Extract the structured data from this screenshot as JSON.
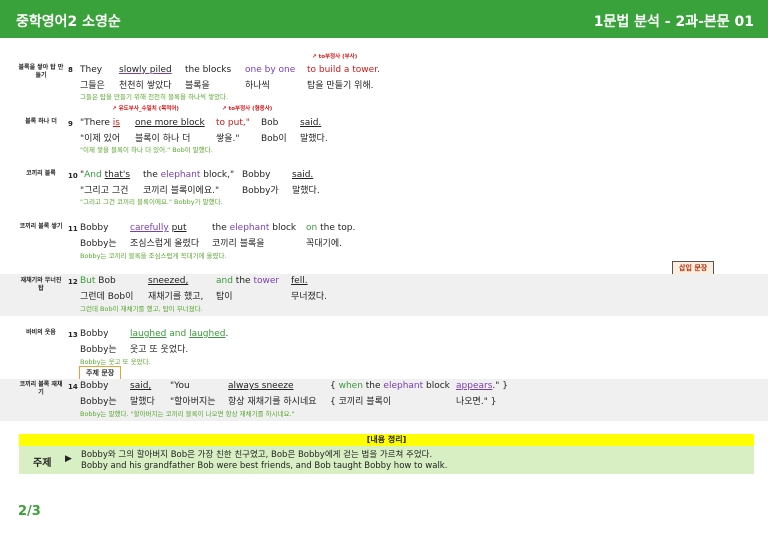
{
  "header": {
    "title_left": "중학영어2 소영순",
    "title_right": "1문법 분석 - 2과-본문 01"
  },
  "rows": [
    {
      "label": "블록을 쌓아 탑 만들기",
      "num": "8",
      "e": [
        "They",
        "slowly piled",
        "the blocks",
        "one by one",
        "to build a tower."
      ],
      "k": [
        "그들은",
        "천천히 쌓았다",
        "블록을",
        "하나씩",
        "탑을 만들기 위해."
      ],
      "small": "그들은 탑을 만들기 위해 천천히 블록을 하나씩 쌓았다.",
      "notes": [
        "to부정사 (부사)"
      ]
    },
    {
      "label": "블록 하나 더",
      "num": "9",
      "e": [
        "\"There is",
        "one more block",
        "to put,\"",
        "Bob",
        "said."
      ],
      "k": [
        "\"이제 있어",
        "블록이 하나 더",
        "쌓을.\"",
        "Bob이",
        "말했다."
      ],
      "small": "\"이제 쌓을 블록이 하나 더 있어.\" Bob이 말했다.",
      "notes": [
        "유도부사_수일치 (목적어)",
        "to부정사 (형용사)"
      ]
    },
    {
      "label": "코끼리 블록",
      "num": "10",
      "e": [
        "\"And that's",
        "the elephant block,\"",
        "Bobby",
        "said."
      ],
      "k": [
        "\"그리고 그건",
        "코끼리 블록이에요.\"",
        "Bobby가",
        "말했다."
      ],
      "small": "\"그리고 그건 코끼리 블록이에요.\" Bobby가 말했다."
    },
    {
      "label": "코끼리 블록 쌓기",
      "num": "11",
      "e": [
        "Bobby",
        "carefully put",
        "the elephant block",
        "on the top."
      ],
      "k": [
        "Bobby는",
        "조심스럽게 올렸다",
        "코끼리 블록을",
        "꼭대기에."
      ],
      "small": "Bobby는 코끼리 블록을 조심스럽게 꼭대기에 올렸다."
    },
    {
      "label": "재채기와 무너진 탑",
      "num": "12",
      "e": [
        "But Bob",
        "sneezed,",
        "and the tower",
        "fell."
      ],
      "k": [
        "그런데 Bob이",
        "재채기를 했고,",
        "탑이",
        "무너졌다."
      ],
      "small": "그런데 Bob이 재채기를 했고, 탑이 무너졌다."
    },
    {
      "label": "바비의 웃음",
      "num": "13",
      "e": [
        "Bobby",
        "laughed and laughed."
      ],
      "k": [
        "Bobby는",
        "웃고 또 웃었다."
      ],
      "small": "Bobby는 웃고 또 웃었다."
    },
    {
      "label": "코끼리 블록 재채기",
      "num": "14",
      "e": [
        "Bobby",
        "said,",
        "\"You",
        "always sneeze",
        "{ when the elephant block",
        "appears.\" }"
      ],
      "k": [
        "Bobby는",
        "말했다",
        "\"할아버지는",
        "항상 재채기를 하시네요",
        "{ 코끼리 블록이",
        "나오면.\" }"
      ],
      "small": "Bobby는 말했다. \"할아버지는 코끼리 블록이 나오면 항상 재채기를 하시네요.\""
    }
  ],
  "tags": {
    "insert": "삽입 문장",
    "topic": "주제 문장"
  },
  "summary": {
    "heading": "[내용 정리]",
    "key": "주제",
    "arrow": "▶",
    "line1": "Bobby와 그의 할아버지 Bob은 가장 친한 친구였고, Bob은 Bobby에게 걷는 법을 가르쳐 주었다.",
    "line2": "Bobby and his grandfather Bob were best friends, and Bob taught Bobby how to walk."
  },
  "page": "2/3"
}
